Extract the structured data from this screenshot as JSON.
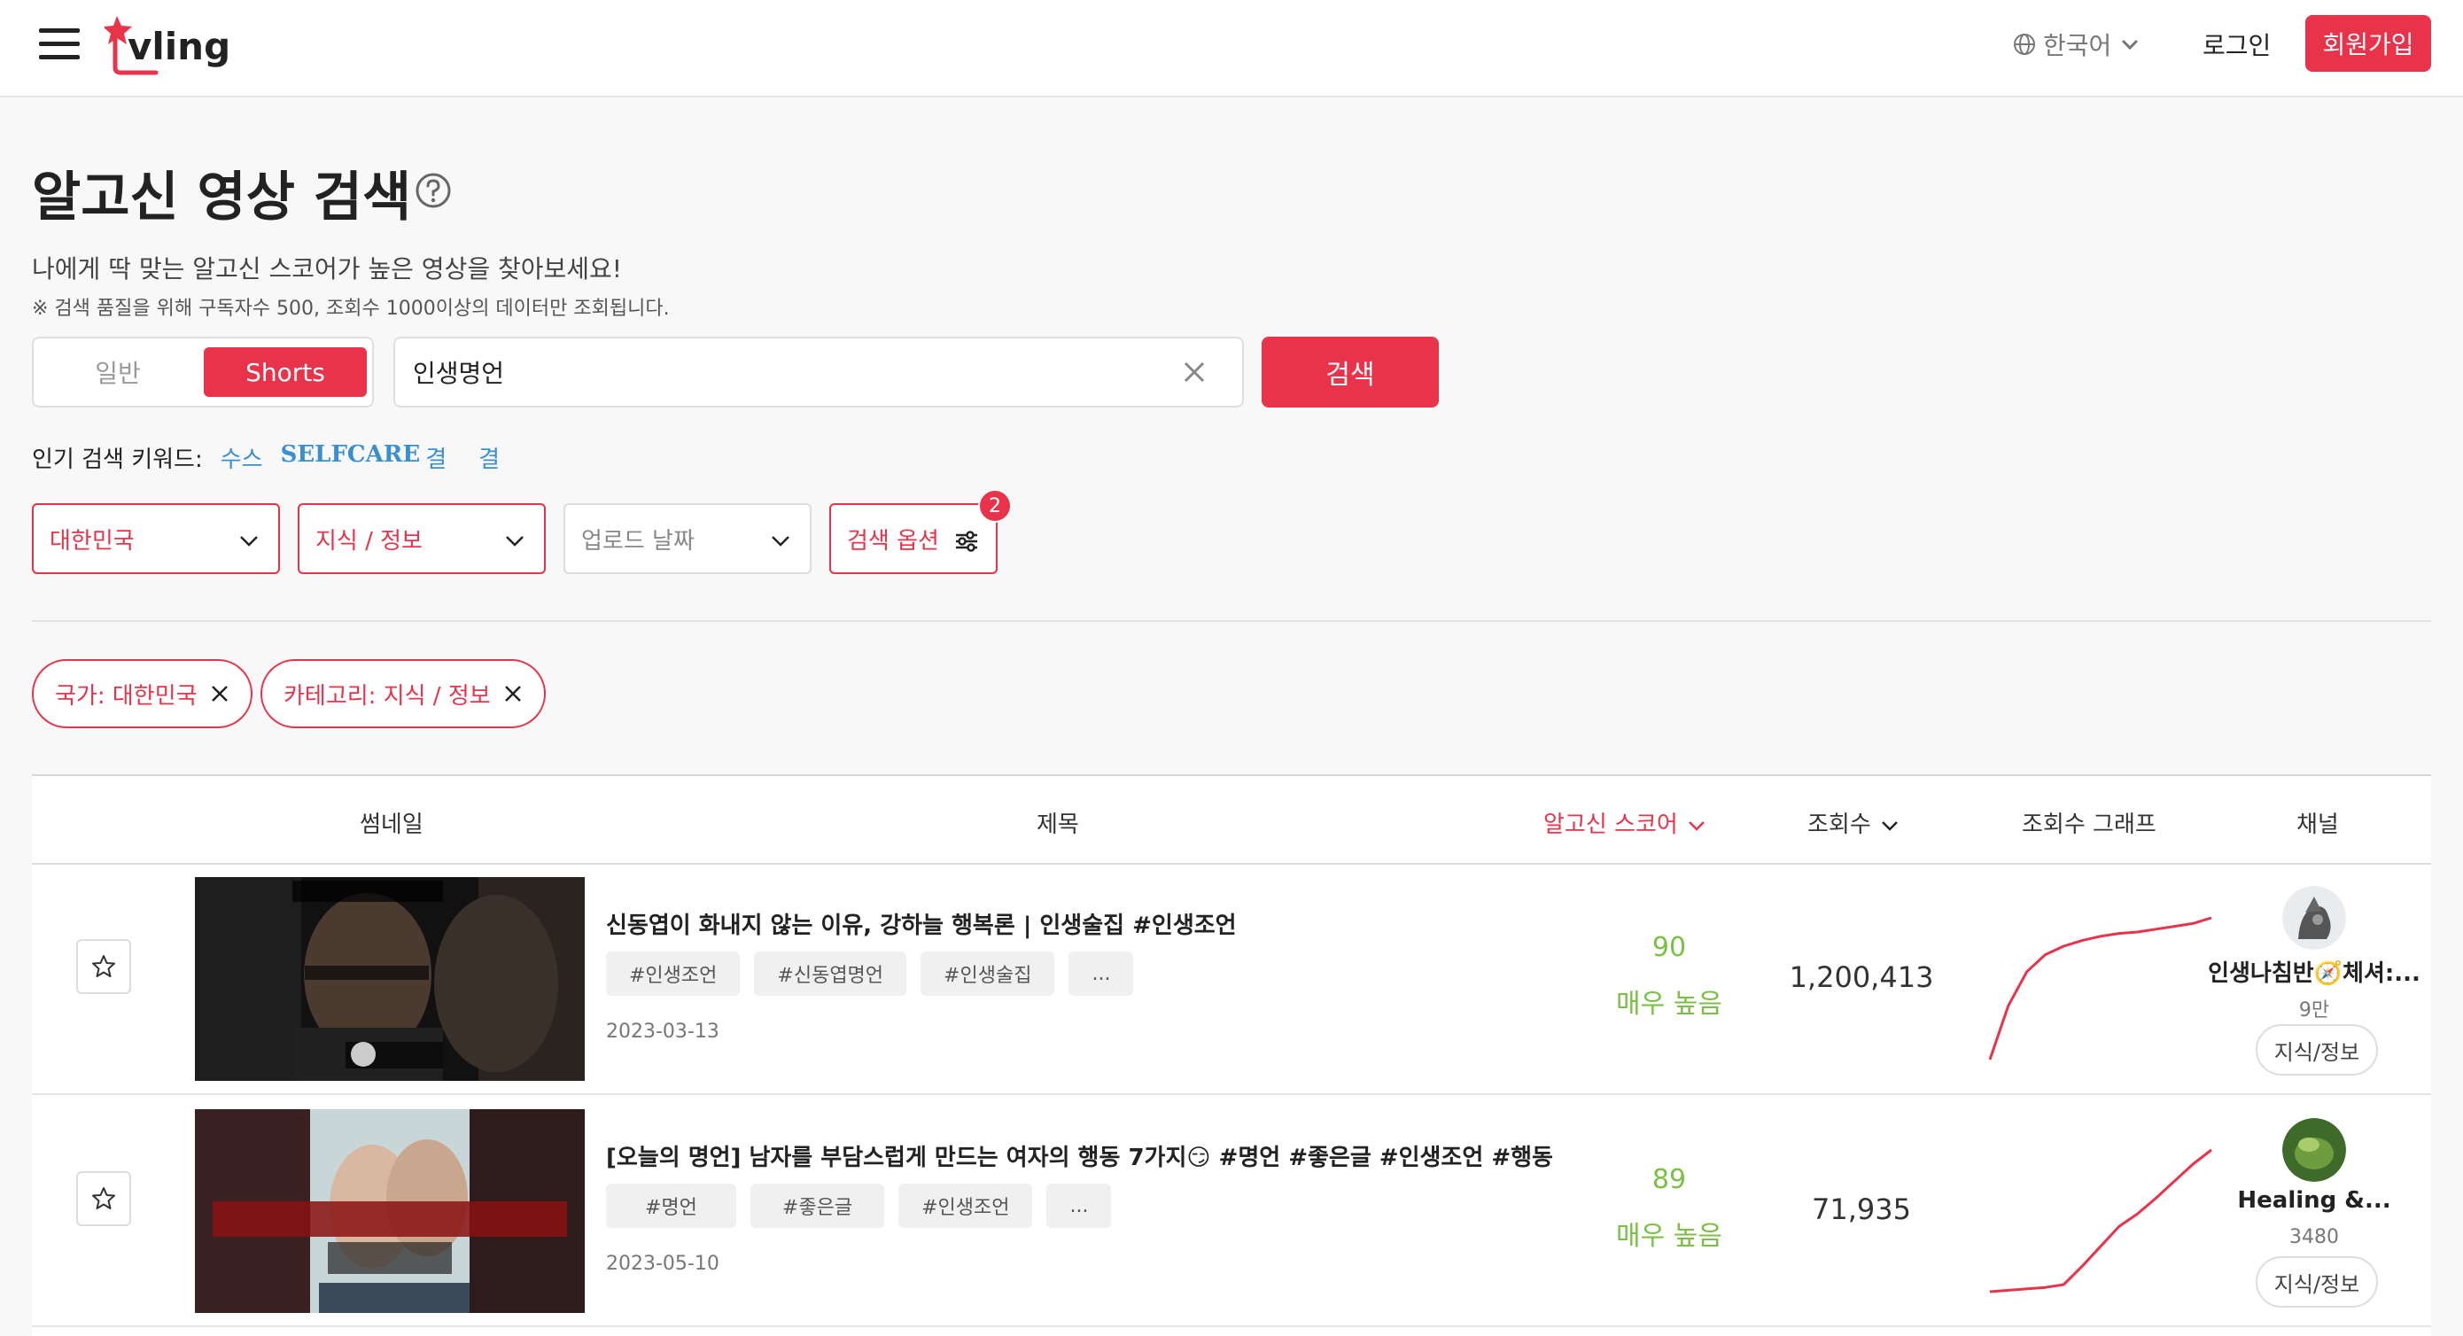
{
  "header": {
    "logo_text": "vling",
    "language": "한국어",
    "login": "로그인",
    "signup": "회원가입"
  },
  "page": {
    "title": "알고신 영상 검색",
    "subtitle": "나에게 딱 맞는 알고신 스코어가 높은 영상을 찾아보세요!",
    "note": "※ 검색 품질을 위해 구독자수 500, 조회수 1000이상의 데이터만 조회됩니다."
  },
  "search": {
    "type_general": "일반",
    "type_shorts": "Shorts",
    "query": "인생명언",
    "button": "검색"
  },
  "popular": {
    "label": "인기 검색 키워드:",
    "keywords": [
      "수스",
      "SELFCARE",
      "결",
      "결"
    ]
  },
  "filters": {
    "country": "대한민국",
    "category": "지식 / 정보",
    "upload_date": "업로드 날짜",
    "options": "검색 옵션",
    "options_badge": "2"
  },
  "chips": [
    "국가: 대한민국",
    "카테고리: 지식 / 정보"
  ],
  "table": {
    "headers": {
      "thumbnail": "썸네일",
      "title": "제목",
      "score": "알고신 스코어",
      "views": "조회수",
      "graph": "조회수 그래프",
      "channel": "채널"
    },
    "rows": [
      {
        "title": "신동엽이 화내지 않는 이유, 강하늘 행복론 | 인생술집 #인생조언",
        "tags": [
          "#인생조언",
          "#신동엽명언",
          "#인생술집",
          "..."
        ],
        "date": "2023-03-13",
        "score": "90",
        "score_label": "매우 높음",
        "views": "1,200,413",
        "channel": "인생나침반🧭체셔:...",
        "subs": "9만",
        "category": "지식/정보",
        "graph": [
          0.0,
          0.38,
          0.62,
          0.74,
          0.8,
          0.84,
          0.87,
          0.89,
          0.9,
          0.92,
          0.94,
          0.96,
          1.0
        ]
      },
      {
        "title": "[오늘의 명언] 남자를 부담스럽게 만드는 여자의 행동 7가지😏 #명언 #좋은글 #인생조언 #행동",
        "tags": [
          "#명언",
          "#좋은글",
          "#인생조언",
          "..."
        ],
        "date": "2023-05-10",
        "score": "89",
        "score_label": "매우 높음",
        "views": "71,935",
        "channel": "Healing &...",
        "subs": "3480",
        "category": "지식/정보",
        "graph": [
          0.0,
          0.01,
          0.02,
          0.03,
          0.05,
          0.18,
          0.32,
          0.46,
          0.55,
          0.66,
          0.78,
          0.9,
          1.0
        ]
      }
    ]
  },
  "colors": {
    "accent": "#e8334a",
    "score": "#7ac143",
    "keyword": "#3a8fd0"
  }
}
